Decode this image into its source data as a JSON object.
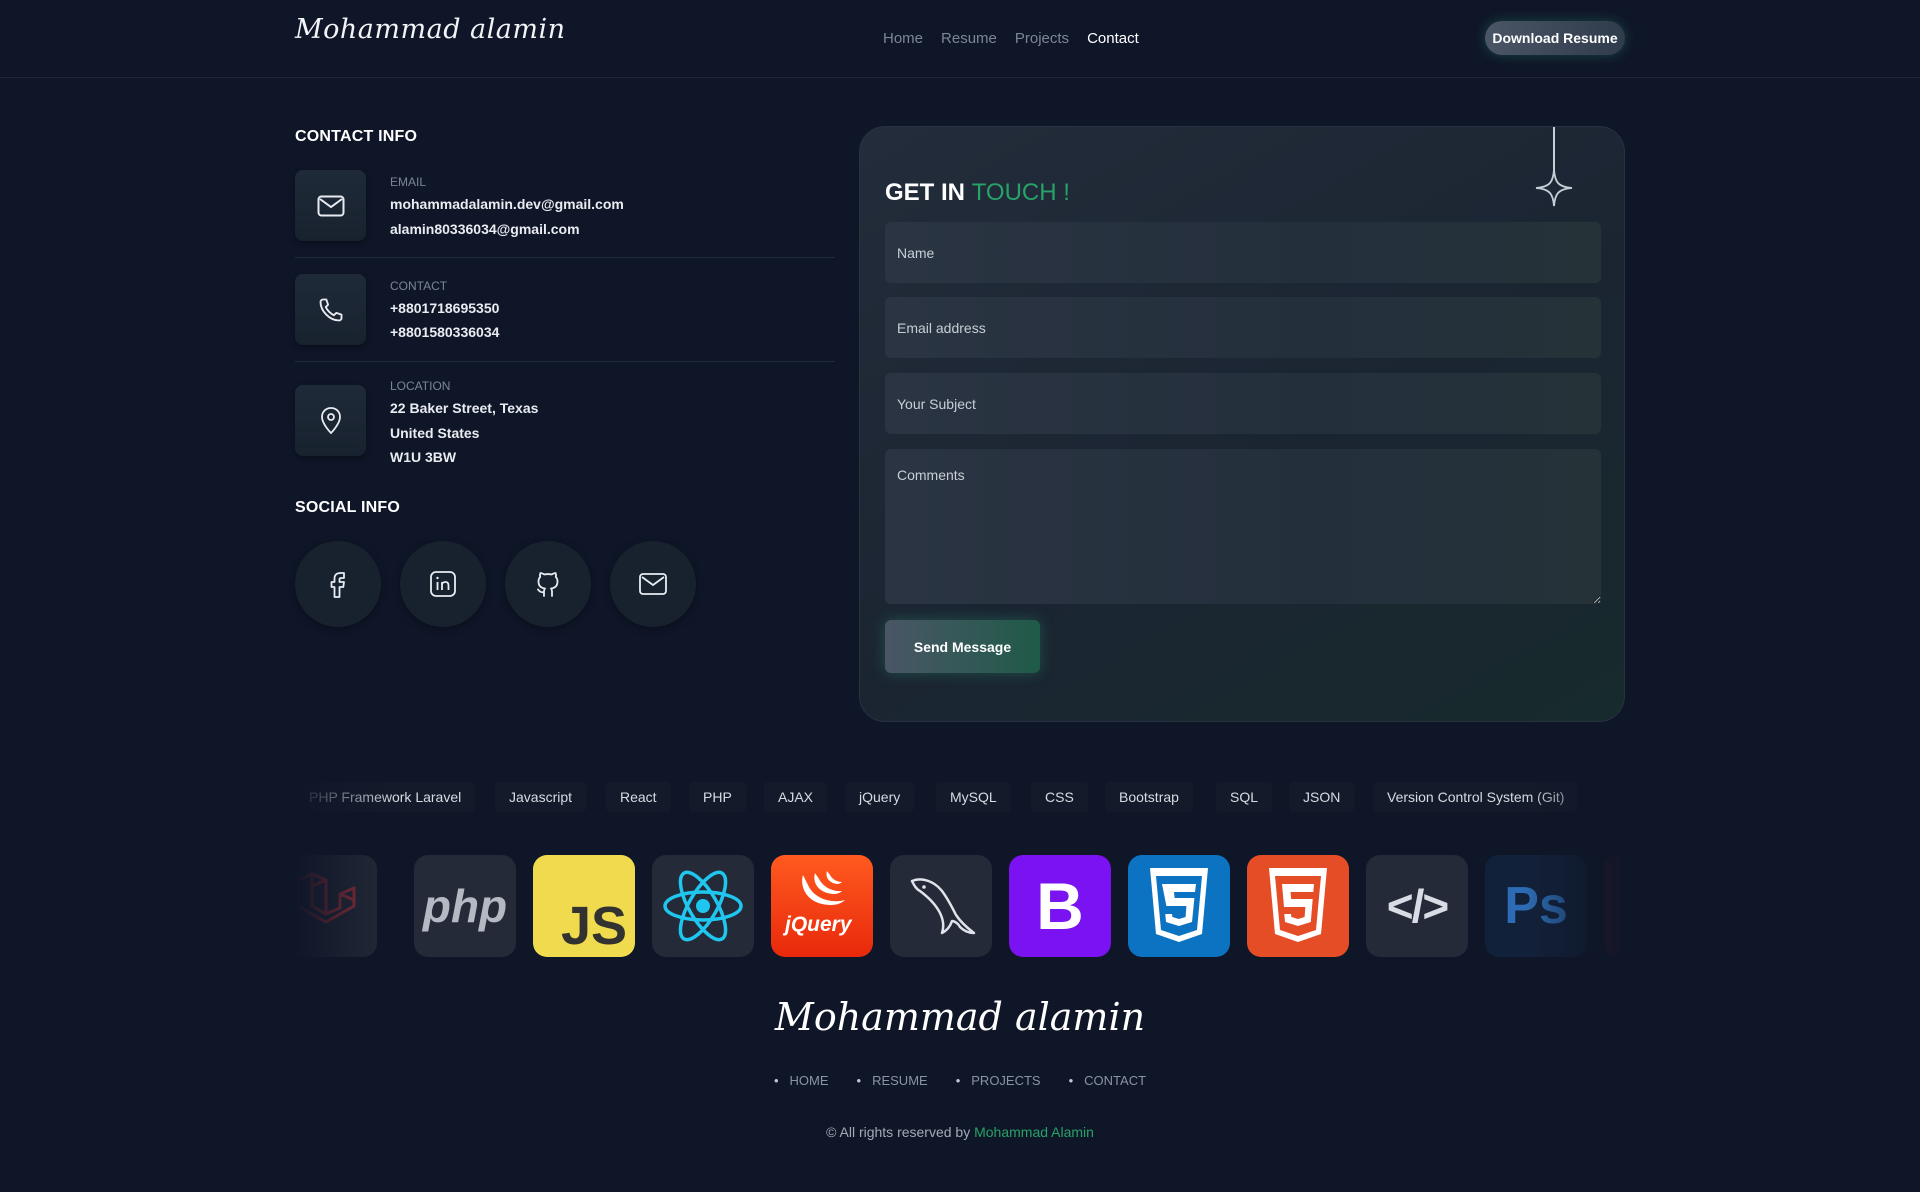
{
  "header": {
    "logo": "Mohammad alamin",
    "nav": [
      "Home",
      "Resume",
      "Projects",
      "Contact"
    ],
    "active_nav": "Contact",
    "download_label": "Download Resume"
  },
  "contact_info": {
    "title": "CONTACT INFO",
    "email": {
      "label": "EMAIL",
      "lines": [
        "mohammadalamin.dev@gmail.com",
        "alamin80336034@gmail.com"
      ]
    },
    "phone": {
      "label": "CONTACT",
      "lines": [
        "+8801718695350",
        "+8801580336034"
      ]
    },
    "location": {
      "label": "LOCATION",
      "lines": [
        "22 Baker Street, Texas",
        "United States",
        "W1U 3BW"
      ]
    }
  },
  "social_info": {
    "title": "SOCIAL INFO",
    "icons": [
      "facebook-icon",
      "linkedin-icon",
      "github-icon",
      "mail-icon"
    ]
  },
  "form": {
    "title_main": "GET IN",
    "title_accent": "TOUCH !",
    "name_placeholder": "Name",
    "email_placeholder": "Email address",
    "subject_placeholder": "Your Subject",
    "comments_placeholder": "Comments",
    "send_label": "Send Message"
  },
  "skills": [
    "PHP Framework Laravel",
    "Javascript",
    "React",
    "PHP",
    "AJAX",
    "jQuery",
    "MySQL",
    "CSS",
    "Bootstrap",
    "SQL",
    "JSON",
    "Version Control System (Git)"
  ],
  "tech_icons": [
    "laravel-icon",
    "php-icon",
    "javascript-icon",
    "react-icon",
    "jquery-icon",
    "mysql-icon",
    "bootstrap-icon",
    "css3-icon",
    "html5-icon",
    "code-icon",
    "photoshop-icon"
  ],
  "tech_text": {
    "php": "php",
    "js": "JS",
    "jquery": "jQuery",
    "bootstrap": "B",
    "code": "</>",
    "ps": "Ps"
  },
  "footer": {
    "logo": "Mohammad alamin",
    "nav": [
      "HOME",
      "RESUME",
      "PROJECTS",
      "CONTACT"
    ],
    "copyright_prefix": "© All rights reserved by",
    "copyright_name": "Mohammad Alamin"
  },
  "colors": {
    "background": "#0f1628",
    "accent": "#27a269",
    "card": "#1b2532"
  }
}
